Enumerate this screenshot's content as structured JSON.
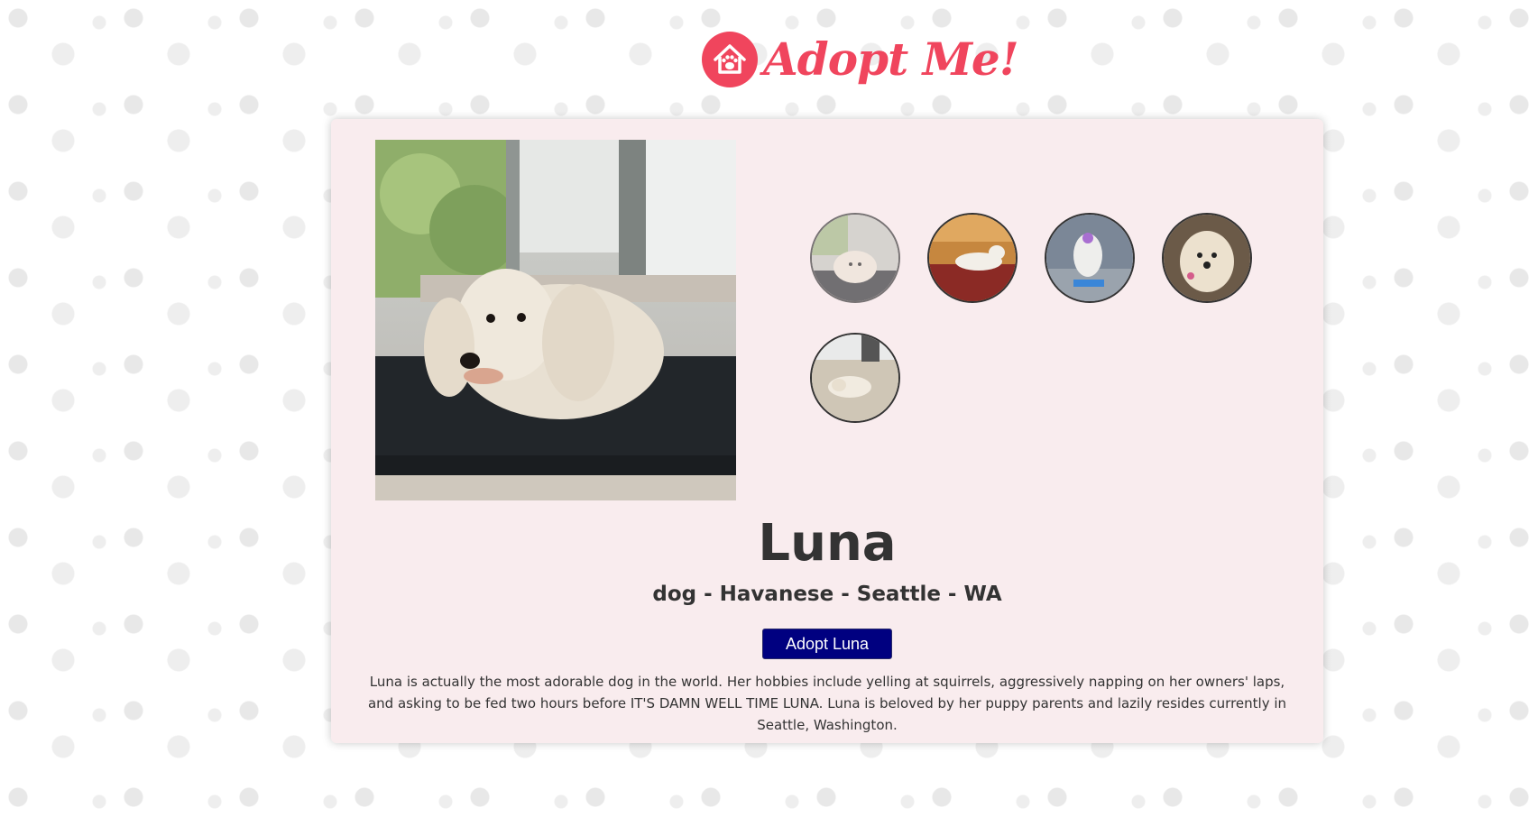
{
  "brand": {
    "logo_text": "Adopt Me!",
    "color": "#f0455d"
  },
  "pet": {
    "name": "Luna",
    "summary": "dog - Havanese - Seattle - WA",
    "adopt_label": "Adopt Luna",
    "description": "Luna is actually the most adorable dog in the world. Her hobbies include yelling at squirrels, aggressively napping on her owners' laps, and asking to be fed two hours before IT'S DAMN WELL TIME LUNA. Luna is beloved by her puppy parents and lazily resides currently in Seattle, Washington."
  },
  "carousel": {
    "thumbnail_count": 5,
    "active_index": 0
  },
  "colors": {
    "card_background": "#f9ecee",
    "button_background": "#000080",
    "text": "#333333"
  }
}
